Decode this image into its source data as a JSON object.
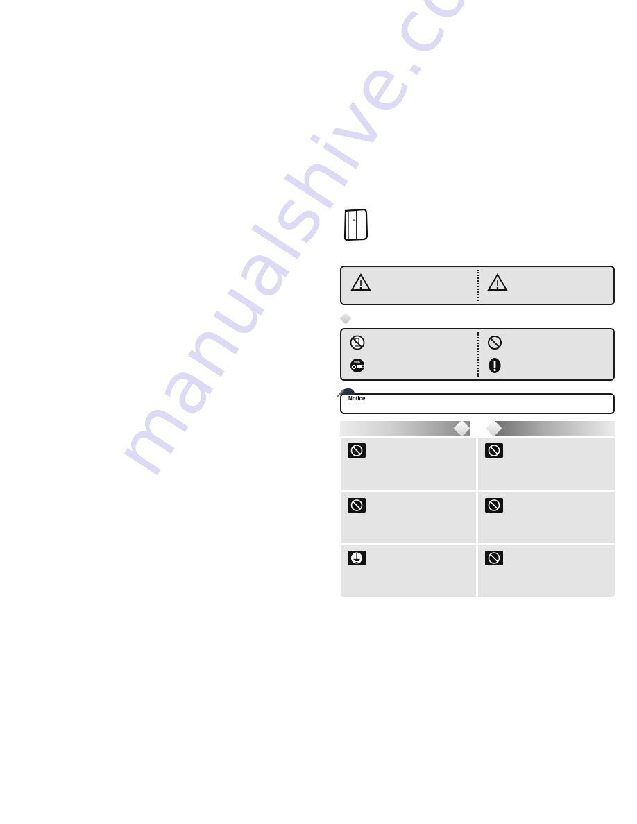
{
  "page": {
    "watermark_text": "manualshive.com",
    "watermark_color": "#d9d6f4"
  },
  "header_icon": "refrigerator-icon",
  "warning_box": {
    "left_icon": "warning-triangle-icon",
    "right_icon": "warning-triangle-icon"
  },
  "symbols_box": {
    "items": [
      {
        "icon": "no-disassembly-icon"
      },
      {
        "icon": "prohibited-icon"
      },
      {
        "icon": "unplug-icon"
      },
      {
        "icon": "mandatory-exclamation-icon"
      }
    ]
  },
  "notice": {
    "label": "Notice"
  },
  "grid": {
    "cells": [
      {
        "icon": "prohibited-icon"
      },
      {
        "icon": "prohibited-icon"
      },
      {
        "icon": "prohibited-icon"
      },
      {
        "icon": "prohibited-icon"
      },
      {
        "icon": "grounding-icon"
      },
      {
        "icon": "prohibited-icon"
      }
    ]
  },
  "colors": {
    "box_fill": "#e3e3e3",
    "border": "#1a1a1a",
    "icon_bg": "#111111"
  }
}
